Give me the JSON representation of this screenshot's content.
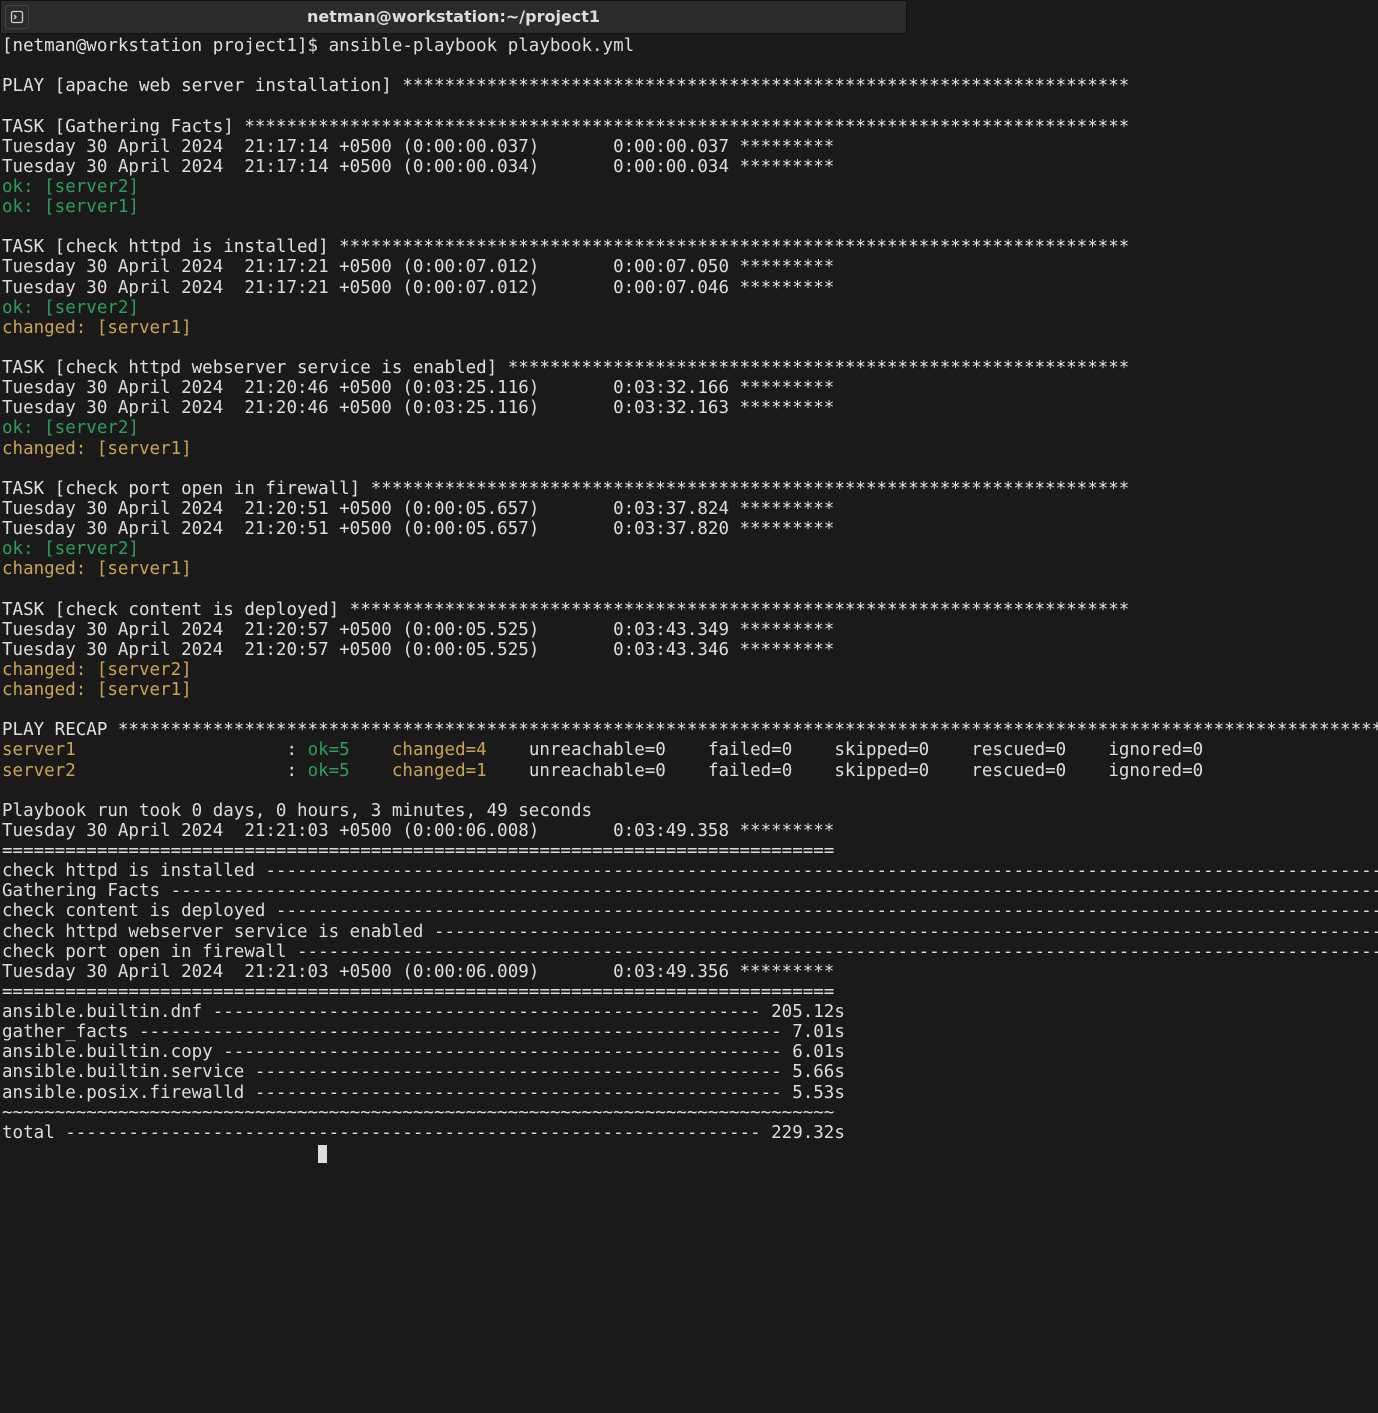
{
  "window": {
    "title": "netman@workstation:~/project1"
  },
  "prompt": "[netman@workstation project1]$ ",
  "command": "ansible-playbook playbook.yml",
  "play_header": "PLAY [apache web server installation] *********************************************************************",
  "tasks": [
    {
      "header": "TASK [Gathering Facts] ************************************************************************************",
      "times": [
        "Tuesday 30 April 2024  21:17:14 +0500 (0:00:00.037)       0:00:00.037 *********",
        "Tuesday 30 April 2024  21:17:14 +0500 (0:00:00.034)       0:00:00.034 *********"
      ],
      "results": [
        {
          "type": "ok",
          "text": "ok: [server2]"
        },
        {
          "type": "ok",
          "text": "ok: [server1]"
        }
      ]
    },
    {
      "header": "TASK [check httpd is installed] ***************************************************************************",
      "times": [
        "Tuesday 30 April 2024  21:17:21 +0500 (0:00:07.012)       0:00:07.050 *********",
        "Tuesday 30 April 2024  21:17:21 +0500 (0:00:07.012)       0:00:07.046 *********"
      ],
      "results": [
        {
          "type": "ok",
          "text": "ok: [server2]"
        },
        {
          "type": "chg",
          "text": "changed: [server1]"
        }
      ]
    },
    {
      "header": "TASK [check httpd webserver service is enabled] ***********************************************************",
      "times": [
        "Tuesday 30 April 2024  21:20:46 +0500 (0:03:25.116)       0:03:32.166 *********",
        "Tuesday 30 April 2024  21:20:46 +0500 (0:03:25.116)       0:03:32.163 *********"
      ],
      "results": [
        {
          "type": "ok",
          "text": "ok: [server2]"
        },
        {
          "type": "chg",
          "text": "changed: [server1]"
        }
      ]
    },
    {
      "header": "TASK [check port open in firewall] ************************************************************************",
      "times": [
        "Tuesday 30 April 2024  21:20:51 +0500 (0:00:05.657)       0:03:37.824 *********",
        "Tuesday 30 April 2024  21:20:51 +0500 (0:00:05.657)       0:03:37.820 *********"
      ],
      "results": [
        {
          "type": "ok",
          "text": "ok: [server2]"
        },
        {
          "type": "chg",
          "text": "changed: [server1]"
        }
      ]
    },
    {
      "header": "TASK [check content is deployed] **************************************************************************",
      "times": [
        "Tuesday 30 April 2024  21:20:57 +0500 (0:00:05.525)       0:03:43.349 *********",
        "Tuesday 30 April 2024  21:20:57 +0500 (0:00:05.525)       0:03:43.346 *********"
      ],
      "results": [
        {
          "type": "chg",
          "text": "changed: [server2]"
        },
        {
          "type": "chg",
          "text": "changed: [server1]"
        }
      ]
    }
  ],
  "recap": {
    "header": "PLAY RECAP ************************************************************************************************************************************************",
    "rows": [
      {
        "host": "server1",
        "host_pad": "server1                    ",
        "ok": "ok=5",
        "chg": "changed=4",
        "rest": "    unreachable=0    failed=0    skipped=0    rescued=0    ignored=0"
      },
      {
        "host": "server2",
        "host_pad": "server2                    ",
        "ok": "ok=5",
        "chg": "changed=1",
        "rest": "    unreachable=0    failed=0    skipped=0    rescued=0    ignored=0"
      }
    ]
  },
  "summary": {
    "run_took": "Playbook run took 0 days, 0 hours, 3 minutes, 49 seconds",
    "ts1": "Tuesday 30 April 2024  21:21:03 +0500 (0:00:06.008)       0:03:49.358 ********* ",
    "sep1": "===============================================================================",
    "task_times": [
      "check httpd is installed -------------------------------------------------------------------------------------------------------------------------------",
      "Gathering Facts ----------------------------------------------------------------------------------------------------------------------------------------",
      "check content is deployed ------------------------------------------------------------------------------------------------------------------------------",
      "check httpd webserver service is enabled ---------------------------------------------------------------------------------------------------------------",
      "check port open in firewall ----------------------------------------------------------------------------------------------------------------------------"
    ],
    "ts2": "Tuesday 30 April 2024  21:21:03 +0500 (0:00:06.009)       0:03:49.356 ********* ",
    "sep2": "===============================================================================",
    "module_times": [
      "ansible.builtin.dnf ---------------------------------------------------- 205.12s",
      "gather_facts ------------------------------------------------------------- 7.01s",
      "ansible.builtin.copy ----------------------------------------------------- 6.01s",
      "ansible.builtin.service -------------------------------------------------- 5.66s",
      "ansible.posix.firewalld -------------------------------------------------- 5.53s"
    ],
    "tilde": "~~~~~~~~~~~~~~~~~~~~~~~~~~~~~~~~~~~~~~~~~~~~~~~~~~~~~~~~~~~~~~~~~~~~~~~~~~~~~~~",
    "total": "total ------------------------------------------------------------------ 229.32s"
  }
}
